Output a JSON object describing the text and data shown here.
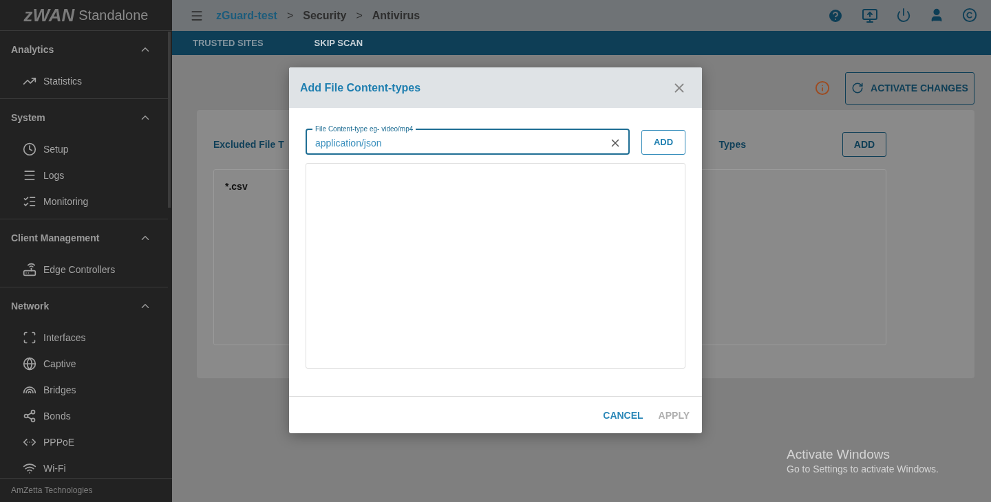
{
  "logo": {
    "mark": "zWAN",
    "product": "Standalone"
  },
  "sidebar": {
    "sections": [
      {
        "title": "Analytics",
        "expanded": true,
        "items": [
          {
            "label": "Statistics"
          }
        ]
      },
      {
        "title": "System",
        "expanded": true,
        "items": [
          {
            "label": "Setup"
          },
          {
            "label": "Logs"
          },
          {
            "label": "Monitoring"
          }
        ]
      },
      {
        "title": "Client Management",
        "expanded": true,
        "items": [
          {
            "label": "Edge Controllers"
          }
        ]
      },
      {
        "title": "Network",
        "expanded": true,
        "items": [
          {
            "label": "Interfaces"
          },
          {
            "label": "Captive"
          },
          {
            "label": "Bridges"
          },
          {
            "label": "Bonds"
          },
          {
            "label": "PPPoE"
          },
          {
            "label": "Wi-Fi"
          }
        ]
      }
    ],
    "footer": "AmZetta Technologies"
  },
  "breadcrumb": [
    {
      "label": "zGuard-test",
      "link": true
    },
    {
      "label": "Security",
      "link": false
    },
    {
      "label": "Antivirus",
      "link": false
    }
  ],
  "breadcrumb_separator": ">",
  "tabs": [
    {
      "label": "TRUSTED SITES",
      "selected": false
    },
    {
      "label": "SKIP SCAN",
      "selected": true
    }
  ],
  "activate_button": "ACTIVATE CHANGES",
  "panels": [
    {
      "title": "Excluded File T",
      "entries": [
        "*.csv"
      ]
    },
    {
      "title": "Types",
      "button": "ADD"
    }
  ],
  "dialog": {
    "title": "Add File Content-types",
    "field": {
      "label": "File Content-type eg- video/mp4",
      "value": "application/json"
    },
    "add_button": "ADD",
    "buttons": [
      {
        "label": "CANCEL",
        "disabled": false
      },
      {
        "label": "APPLY",
        "disabled": true
      }
    ]
  },
  "os_notice": {
    "title": "Activate Windows",
    "text": "Go to Settings to activate Windows."
  }
}
